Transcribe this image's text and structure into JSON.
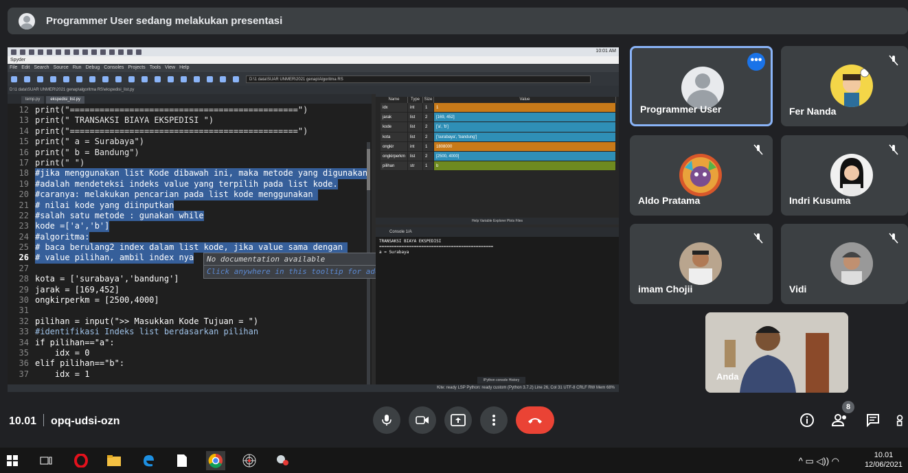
{
  "banner": {
    "text": "Programmer User sedang melakukan presentasi"
  },
  "screen": {
    "clock": "10:01 AM",
    "title": "Spyder",
    "menu": [
      "File",
      "Edit",
      "Search",
      "Source",
      "Run",
      "Debug",
      "Consoles",
      "Projects",
      "Tools",
      "View",
      "Help"
    ],
    "path_box": "D:\\1 data\\SUAR UNMER\\2021 genap\\Algoritma RS",
    "filepath": "D:\\1 data\\SUAR UNMER\\2021 genap\\algoritma RS\\ekspedisi_list.py",
    "editor_tabs": [
      "temp.py",
      "ekspedisi_list.py"
    ],
    "code_lines": [
      {
        "n": "12",
        "t": "print(\"==============================================\")",
        "cls": "s"
      },
      {
        "n": "13",
        "t": "print(\" TRANSAKSI BIAYA EKSPEDISI \")",
        "cls": "s"
      },
      {
        "n": "14",
        "t": "print(\"==============================================\")",
        "cls": "s"
      },
      {
        "n": "15",
        "t": "print(\" a = Surabaya\")",
        "cls": "s"
      },
      {
        "n": "16",
        "t": "print(\" b = Bandung\")",
        "cls": "s"
      },
      {
        "n": "17",
        "t": "print(\" \")",
        "cls": "s"
      },
      {
        "n": "18",
        "t": "#jika menggunakan list Kode dibawah ini, maka metode yang digunakan",
        "cls": "hl"
      },
      {
        "n": "19",
        "t": "#adalah mendeteksi indeks value yang terpilih pada list kode.",
        "cls": "hl"
      },
      {
        "n": "20",
        "t": "#caranya: melakukan pencarian pada list kode menggunakan ",
        "cls": "hl"
      },
      {
        "n": "21",
        "t": "# nilai kode yang diinputkan",
        "cls": "hl"
      },
      {
        "n": "22",
        "t": "#salah satu metode : gunakan while",
        "cls": "hl"
      },
      {
        "n": "23",
        "t": "kode =['a','b']",
        "cls": "hl"
      },
      {
        "n": "24",
        "t": "#algoritma:",
        "cls": "hl"
      },
      {
        "n": "25",
        "t": "# baca berulang2 index dalam list kode, jika value sama dengan ",
        "cls": "hl"
      },
      {
        "n": "26",
        "t": "# value pilihan, ambil index nya",
        "cls": "hl"
      },
      {
        "n": "27",
        "t": "",
        "cls": ""
      },
      {
        "n": "28",
        "t": "kota = ['surabaya','bandung']",
        "cls": ""
      },
      {
        "n": "29",
        "t": "jarak = [169,452]",
        "cls": ""
      },
      {
        "n": "30",
        "t": "ongkirperkm = [2500,4000]",
        "cls": ""
      },
      {
        "n": "31",
        "t": "",
        "cls": ""
      },
      {
        "n": "32",
        "t": "pilihan = input(\">> Masukkan Kode Tujuan = \")",
        "cls": ""
      },
      {
        "n": "33",
        "t": "#identifikasi Indeks list berdasarkan pilihan",
        "cls": "c"
      },
      {
        "n": "34",
        "t": "if pilihan==\"a\":",
        "cls": ""
      },
      {
        "n": "35",
        "t": "    idx = 0",
        "cls": ""
      },
      {
        "n": "36",
        "t": "elif pilihan==\"b\":",
        "cls": ""
      },
      {
        "n": "37",
        "t": "    idx = 1",
        "cls": ""
      }
    ],
    "tooltip": {
      "line1": "No documentation available",
      "line2": "Click anywhere in this tooltip for additional help"
    },
    "var_headers": [
      "Name",
      "Type",
      "Size",
      "Value"
    ],
    "variables": [
      {
        "name": "idx",
        "type": "int",
        "size": "1",
        "value": "1",
        "color": "#c87a19"
      },
      {
        "name": "jarak",
        "type": "list",
        "size": "2",
        "value": "[169, 452]",
        "color": "#2f8fb6"
      },
      {
        "name": "kode",
        "type": "list",
        "size": "2",
        "value": "['a', 'b']",
        "color": "#2f8fb6"
      },
      {
        "name": "kota",
        "type": "list",
        "size": "2",
        "value": "['surabaya', 'bandung']",
        "color": "#2f8fb6"
      },
      {
        "name": "ongkir",
        "type": "int",
        "size": "1",
        "value": "1808000",
        "color": "#c87a19"
      },
      {
        "name": "ongkirperkm",
        "type": "list",
        "size": "2",
        "value": "[2500, 4000]",
        "color": "#2f8fb6"
      },
      {
        "name": "pilihan",
        "type": "str",
        "size": "1",
        "value": "b",
        "color": "#6e8a1f"
      }
    ],
    "var_tabs": "Help  Variable Explorer  Plots  Files",
    "console_tab": "Console 1/A",
    "console_out": [
      "TRANSAKSI BIAYA EKSPEDISI",
      "==============================================",
      "a = Surabaya"
    ],
    "console_tabs": "IPython console  History",
    "status": "Kite: ready    LSP Python: ready    custom (Python 3.7.2)    Line 26, Col 31    UTF-8    CRLF    RW    Mem 68%"
  },
  "participants": [
    {
      "name": "Programmer User",
      "selected": true
    },
    {
      "name": "Fer Nanda"
    },
    {
      "name": "Aldo Pratama"
    },
    {
      "name": "Indri Kusuma"
    },
    {
      "name": "imam Chojii"
    },
    {
      "name": "Vidi"
    }
  ],
  "self": {
    "name": "Anda"
  },
  "meeting": {
    "time": "10.01",
    "code": "opq-udsi-ozn",
    "people_count": "8"
  },
  "taskbar": {
    "time": "10.01",
    "date": "12/06/2021"
  },
  "colors": {
    "bg": "#202124",
    "tile": "#3c4043",
    "accent": "#8ab4f8",
    "end": "#ea4335"
  }
}
